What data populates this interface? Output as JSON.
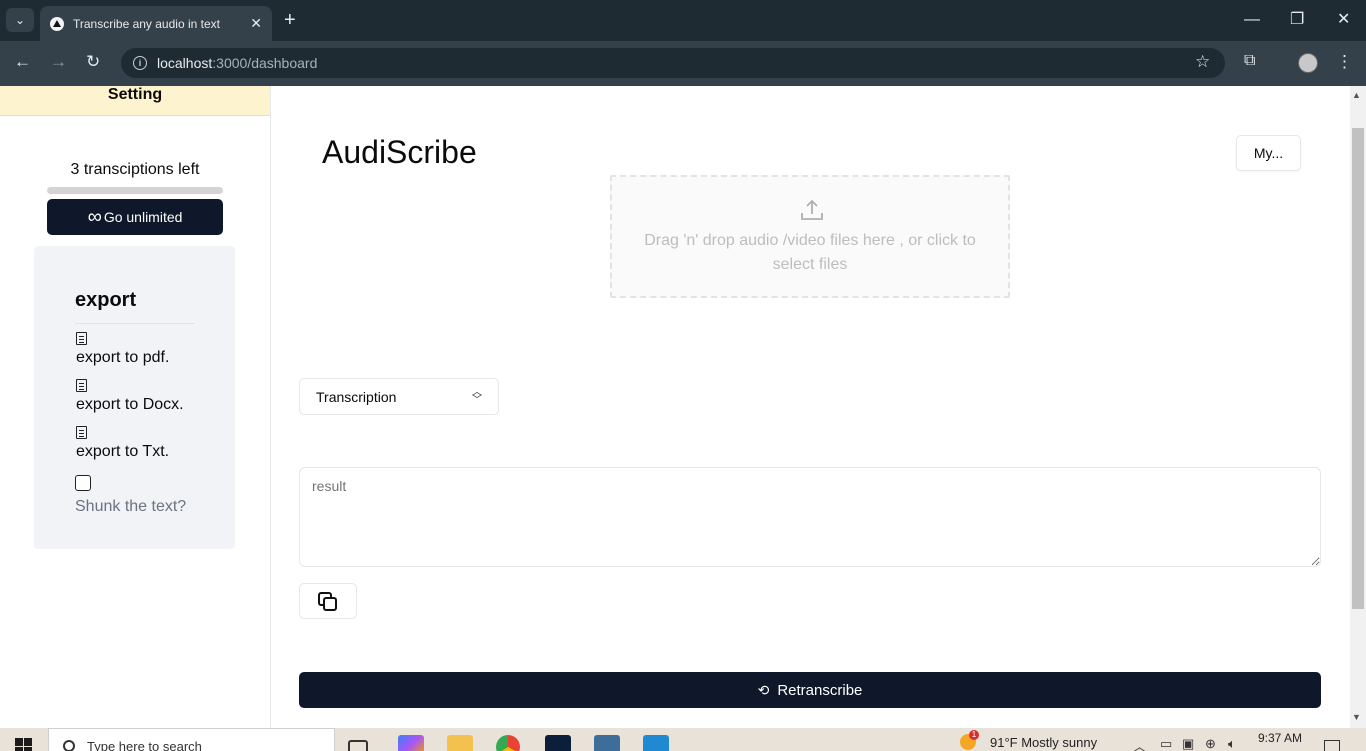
{
  "browser": {
    "tab_title": "Transcribe any audio in text",
    "new_tab": "+",
    "url_host": "localhost",
    "url_path": ":3000/dashboard",
    "window_controls": {
      "minimize": "—",
      "restore": "❐",
      "close": "✕"
    }
  },
  "sidebar": {
    "setting_label": "Setting",
    "transcriptions_left": "3 transciptions left",
    "usage_progress_fraction": 0.0,
    "go_unlimited_icon": "∞",
    "go_unlimited_label": "Go unlimited",
    "export": {
      "title": "export",
      "items": [
        {
          "label": "export to pdf.",
          "icon": "document-icon"
        },
        {
          "label": "export to Docx.",
          "icon": "document-icon"
        },
        {
          "label": "export to Txt.",
          "icon": "document-icon"
        }
      ],
      "shunk_label": "Shunk the text?",
      "shunk_checked": false
    }
  },
  "main": {
    "app_title": "AudiScribe",
    "account_button": "My...",
    "dropzone_text": "Drag 'n' drop audio /video files here , or click to select files",
    "mode_select": {
      "value": "Transcription"
    },
    "result_placeholder": "result",
    "retranscribe_label": "Retranscribe"
  },
  "taskbar": {
    "search_placeholder": "Type here to search",
    "weather": "91°F  Mostly sunny",
    "weather_badge": "1",
    "time": "9:37 AM"
  },
  "colors": {
    "primary": "#0f172a",
    "setting_bar": "#fdf3cf",
    "export_card": "#f1f3f6"
  }
}
